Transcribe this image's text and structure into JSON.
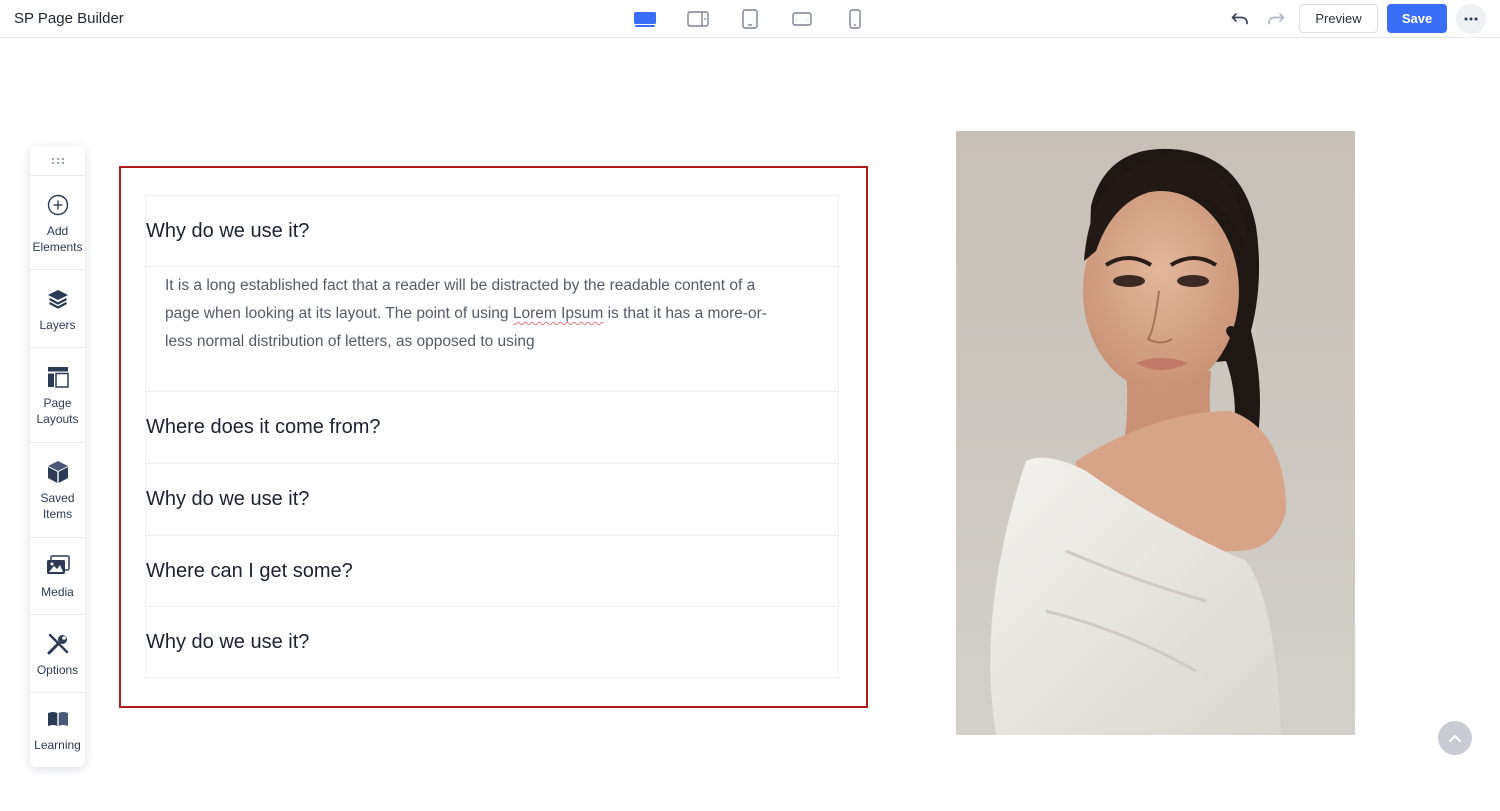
{
  "app": {
    "title": "SP Page Builder"
  },
  "devices": [
    {
      "name": "desktop",
      "active": true
    },
    {
      "name": "laptop",
      "active": false
    },
    {
      "name": "tablet",
      "active": false
    },
    {
      "name": "tablet-landscape",
      "active": false
    },
    {
      "name": "mobile",
      "active": false
    }
  ],
  "toolbar": {
    "preview_label": "Preview",
    "save_label": "Save"
  },
  "sidebar": {
    "items": [
      {
        "label": "Add\nElements",
        "icon": "plus-circle-icon"
      },
      {
        "label": "Layers",
        "icon": "layers-icon"
      },
      {
        "label": "Page\nLayouts",
        "icon": "page-layout-icon"
      },
      {
        "label": "Saved\nItems",
        "icon": "box-icon"
      },
      {
        "label": "Media",
        "icon": "media-icon"
      },
      {
        "label": "Options",
        "icon": "wrench-screwdriver-icon"
      },
      {
        "label": "Learning",
        "icon": "book-icon"
      }
    ]
  },
  "accordion": {
    "items": [
      {
        "title": "Why do we use it?",
        "expanded": true
      },
      {
        "title": "Where does it come from?",
        "expanded": false
      },
      {
        "title": "Why do we use it?",
        "expanded": false
      },
      {
        "title": "Where can I get some?",
        "expanded": false
      },
      {
        "title": "Why do we use it?",
        "expanded": false
      }
    ],
    "body_before": "It is a long established fact that a reader will be distracted by the readable content of a page when looking at its layout. The point of using ",
    "body_flagged": "Lorem Ipsum",
    "body_after": " is that it has a more-or-less normal distribution of letters, as opposed to using"
  },
  "colors": {
    "accent": "#3b6ef6",
    "selection_border": "#b01c1c",
    "icon": "#2c3a55"
  }
}
